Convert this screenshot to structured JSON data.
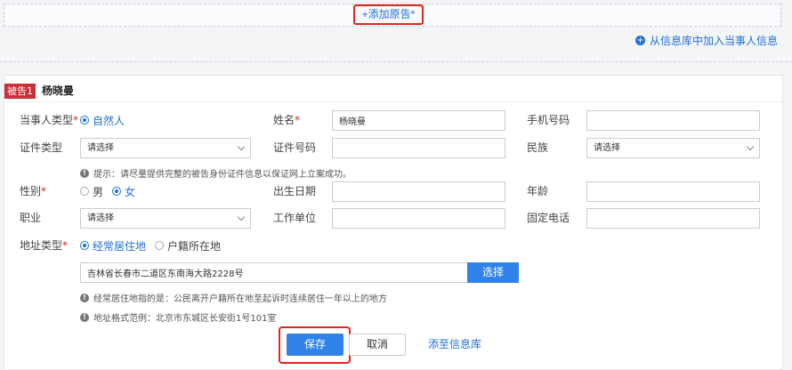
{
  "top": {
    "add_plaintiff": "+添加原告*",
    "add_from_library": "从信息库中加入当事人信息"
  },
  "card": {
    "tag": "被告1",
    "name": "杨晓曼"
  },
  "form": {
    "party_type": {
      "label": "当事人类型",
      "req": "*",
      "option": "自然人"
    },
    "name": {
      "label": "姓名",
      "req": "*",
      "value": "杨晓曼"
    },
    "phone": {
      "label": "手机号码",
      "value": ""
    },
    "id_type": {
      "label": "证件类型",
      "value": "请选择"
    },
    "id_number": {
      "label": "证件号码",
      "value": ""
    },
    "ethnicity": {
      "label": "民族",
      "value": "请选择"
    },
    "id_hint": "提示：请尽量提供完整的被告身份证件信息以保证网上立案成功。",
    "gender": {
      "label": "性别",
      "req": "*",
      "male": "男",
      "female": "女"
    },
    "birthdate": {
      "label": "出生日期",
      "value": ""
    },
    "age": {
      "label": "年龄",
      "value": ""
    },
    "occupation": {
      "label": "职业",
      "value": "请选择"
    },
    "workplace": {
      "label": "工作单位",
      "value": ""
    },
    "landline": {
      "label": "固定电话",
      "value": ""
    },
    "address_type": {
      "label": "地址类型",
      "req": "*",
      "opt1": "经常居住地",
      "opt2": "户籍所在地"
    },
    "address": {
      "value": "吉林省长春市二道区东南海大路2228号",
      "select_label": "选择"
    },
    "address_hint1": "经常居住地指的是：公民离开户籍所在地至起诉时连续居住一年以上的地方",
    "address_hint2": "地址格式范例：北京市东城区长安街1号101室"
  },
  "actions": {
    "save": "保存",
    "cancel": "取消",
    "add_to_library": "添至信息库"
  }
}
